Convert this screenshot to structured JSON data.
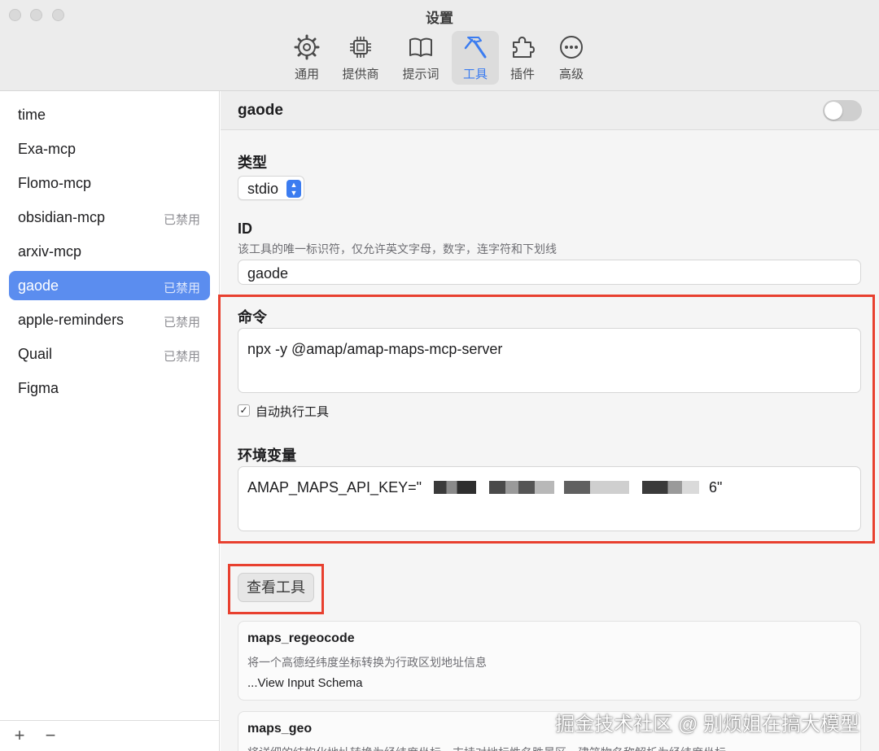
{
  "window": {
    "title": "设置"
  },
  "toolbar": {
    "tabs": [
      {
        "label": "通用",
        "icon": "gear-icon"
      },
      {
        "label": "提供商",
        "icon": "chip-icon"
      },
      {
        "label": "提示词",
        "icon": "book-icon"
      },
      {
        "label": "工具",
        "icon": "hammer-icon",
        "active": true
      },
      {
        "label": "插件",
        "icon": "puzzle-icon"
      },
      {
        "label": "高级",
        "icon": "ellipsis-circle-icon"
      }
    ]
  },
  "sidebar": {
    "items": [
      {
        "name": "time",
        "badge": ""
      },
      {
        "name": "Exa-mcp",
        "badge": ""
      },
      {
        "name": "Flomo-mcp",
        "badge": ""
      },
      {
        "name": "obsidian-mcp",
        "badge": "已禁用"
      },
      {
        "name": "arxiv-mcp",
        "badge": ""
      },
      {
        "name": "gaode",
        "badge": "已禁用",
        "selected": true
      },
      {
        "name": "apple-reminders",
        "badge": "已禁用"
      },
      {
        "name": "Quail",
        "badge": "已禁用"
      },
      {
        "name": "Figma",
        "badge": ""
      }
    ],
    "add_label": "+",
    "remove_label": "−"
  },
  "detail": {
    "title": "gaode",
    "enabled": false,
    "type_label": "类型",
    "type_value": "stdio",
    "id_label": "ID",
    "id_hint": "该工具的唯一标识符，仅允许英文字母，数字，连字符和下划线",
    "id_value": "gaode",
    "command_label": "命令",
    "command_value": "npx -y @amap/amap-maps-mcp-server",
    "auto_run_label": "自动执行工具",
    "auto_run_checked": true,
    "env_label": "环境变量",
    "env_prefix": "AMAP_MAPS_API_KEY=\"",
    "env_tail": "6\"",
    "view_tools_label": "查看工具"
  },
  "tools": [
    {
      "name": "maps_regeocode",
      "desc": "将一个高德经纬度坐标转换为行政区划地址信息",
      "link": "...View Input Schema"
    },
    {
      "name": "maps_geo",
      "desc": "将详细的结构化地址转换为经纬度坐标。支持对地标性名胜景区、建筑物名称解析为经纬度坐标"
    }
  ],
  "watermark": "掘金技术社区 @ 别烦姐在搞大模型",
  "colors": {
    "accent": "#3b7cf0",
    "selection": "#5b8def",
    "highlight": "#e8402f"
  }
}
